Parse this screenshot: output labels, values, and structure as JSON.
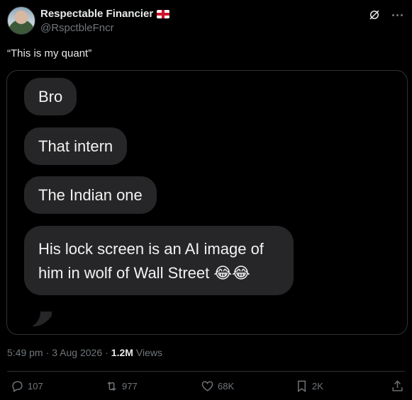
{
  "author": {
    "display_name": "Respectable Financier",
    "handle": "@RspctbleFncr",
    "flag_icon": "england-flag-icon"
  },
  "tweet": {
    "text": "“This is my quant”"
  },
  "media": {
    "messages": [
      "Bro",
      "That intern",
      "The Indian one",
      "His lock screen is an AI image of him in wolf of Wall Street 😂😂"
    ]
  },
  "meta": {
    "time": "5:49 pm",
    "sep1": "·",
    "date": "3 Aug 2026",
    "sep2": "·",
    "views_count": "1.2M",
    "views_label": "Views"
  },
  "actions": {
    "replies": "107",
    "retweets": "977",
    "likes": "68K",
    "bookmarks": "2K"
  },
  "colors": {
    "background": "#000000",
    "bubble": "#262628",
    "muted": "#71767b",
    "text": "#e7e9ea"
  }
}
